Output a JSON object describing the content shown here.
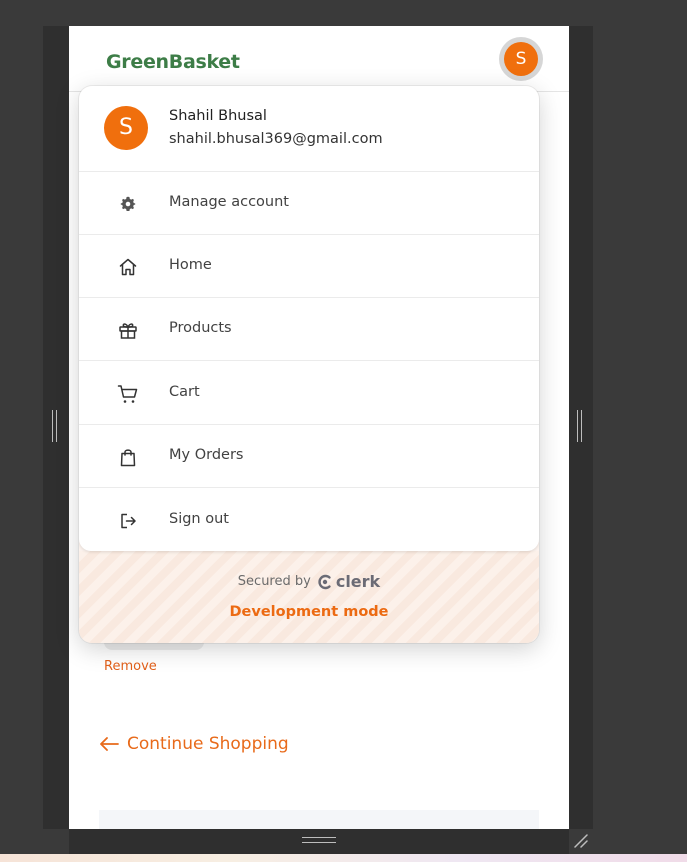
{
  "brand": {
    "name": "GreenBasket",
    "color": "#3d7d47"
  },
  "header": {
    "avatar_initial": "S",
    "avatar_color": "#f06f0d"
  },
  "user": {
    "initial": "S",
    "name": "Shahil Bhusal",
    "email": "shahil.bhusal369@gmail.com"
  },
  "menu": {
    "items": [
      {
        "label": "Manage account",
        "icon": "gear-icon"
      },
      {
        "label": "Home",
        "icon": "home-icon"
      },
      {
        "label": "Products",
        "icon": "gift-icon"
      },
      {
        "label": "Cart",
        "icon": "cart-icon"
      },
      {
        "label": "My Orders",
        "icon": "shopping-bag-icon"
      },
      {
        "label": "Sign out",
        "icon": "sign-out-icon"
      }
    ]
  },
  "footer": {
    "secured_by": "Secured by",
    "provider": "clerk",
    "dev_mode": "Development mode"
  },
  "page": {
    "remove_label": "Remove",
    "continue_label": "Continue Shopping",
    "accent": "#e86a1a"
  }
}
